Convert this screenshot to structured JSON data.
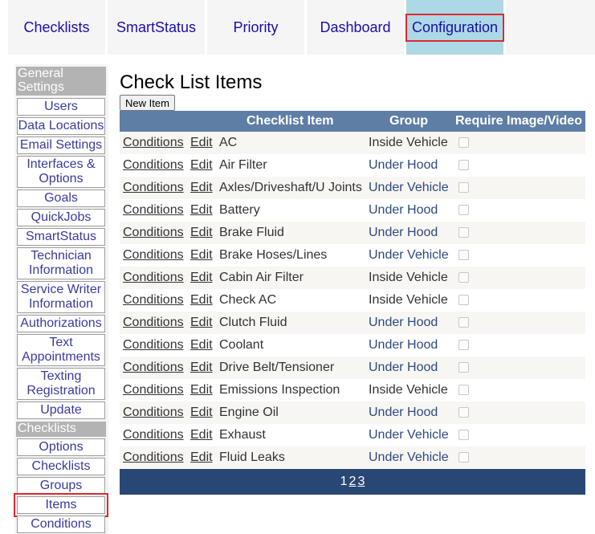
{
  "top_tabs": [
    {
      "label": "Checklists",
      "active": false
    },
    {
      "label": "SmartStatus",
      "active": false
    },
    {
      "label": "Priority",
      "active": false
    },
    {
      "label": "Dashboard",
      "active": false
    },
    {
      "label": "Configuration",
      "active": true
    }
  ],
  "sidebar": {
    "sections": [
      {
        "heading": "General Settings",
        "items": [
          "Users",
          "Data Locations",
          "Email Settings",
          "Interfaces & Options",
          "Goals",
          "QuickJobs",
          "SmartStatus",
          "Technician Information",
          "Service Writer Information",
          "Authorizations",
          "Text Appointments",
          "Texting Registration",
          "Update"
        ]
      },
      {
        "heading": "Checklists",
        "items": [
          "Options",
          "Checklists",
          "Groups",
          "Items",
          "Conditions"
        ]
      }
    ],
    "highlighted_item": "Items"
  },
  "main": {
    "title": "Check List Items",
    "new_item_label": "New Item",
    "columns": [
      "Checklist Item",
      "Group",
      "Require Image/Video"
    ],
    "conditions_label": "Conditions",
    "edit_label": "Edit",
    "rows": [
      {
        "item": "AC",
        "group": "Inside Vehicle",
        "require": false
      },
      {
        "item": "Air Filter",
        "group": "Under Hood",
        "require": false
      },
      {
        "item": "Axles/Driveshaft/U Joints",
        "group": "Under Vehicle",
        "require": false
      },
      {
        "item": "Battery",
        "group": "Under Hood",
        "require": false
      },
      {
        "item": "Brake Fluid",
        "group": "Under Hood",
        "require": false
      },
      {
        "item": "Brake Hoses/Lines",
        "group": "Under Vehicle",
        "require": false
      },
      {
        "item": "Cabin Air Filter",
        "group": "Inside Vehicle",
        "require": false
      },
      {
        "item": "Check AC",
        "group": "Inside Vehicle",
        "require": false
      },
      {
        "item": "Clutch Fluid",
        "group": "Under Hood",
        "require": false
      },
      {
        "item": "Coolant",
        "group": "Under Hood",
        "require": false
      },
      {
        "item": "Drive Belt/Tensioner",
        "group": "Under Hood",
        "require": false
      },
      {
        "item": "Emissions Inspection",
        "group": "Inside Vehicle",
        "require": false
      },
      {
        "item": "Engine Oil",
        "group": "Under Hood",
        "require": false
      },
      {
        "item": "Exhaust",
        "group": "Under Vehicle",
        "require": false
      },
      {
        "item": "Fluid Leaks",
        "group": "Under Vehicle",
        "require": false
      }
    ],
    "pager": {
      "current": "1",
      "pages": [
        "2",
        "3"
      ]
    }
  },
  "colors": {
    "tab_active_bg": "#add8e6",
    "highlight_border": "#e0282f",
    "grid_header_bg": "#5e7ea6",
    "pager_bg": "#284775",
    "sidebar_heading_bg": "#b3b3b3"
  }
}
